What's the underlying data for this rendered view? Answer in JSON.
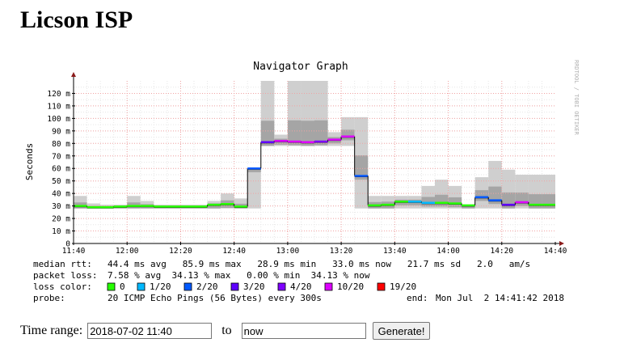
{
  "page": {
    "title": "Licson ISP"
  },
  "graph": {
    "title": "Navigator Graph",
    "ylabel": "Seconds",
    "watermark": "RRDTOOL / TOBI OETIKER",
    "stats": {
      "median_label": "median rtt:",
      "median_values": "44.4 ms avg   85.9 ms max   28.9 ms min   33.0 ms now   21.7 ms sd   2.0   am/s",
      "loss_label": "packet loss:",
      "loss_values": "7.58 % avg  34.13 % max   0.00 % min  34.13 % now",
      "color_label": "loss color:",
      "probe_label": "probe:",
      "probe_values": "20 ICMP Echo Pings (56 Bytes) every 300s",
      "end_label": "end:",
      "end_value": "Mon Jul  2 14:41:42 2018"
    },
    "loss_legend": [
      {
        "label": "0",
        "color": "#26ff00"
      },
      {
        "label": "1/20",
        "color": "#00b8ff"
      },
      {
        "label": "2/20",
        "color": "#0059ff"
      },
      {
        "label": "3/20",
        "color": "#5e00ff"
      },
      {
        "label": "4/20",
        "color": "#7e00ff"
      },
      {
        "label": "10/20",
        "color": "#dd00ff"
      },
      {
        "label": "19/20",
        "color": "#ff0000"
      }
    ]
  },
  "chart_data": {
    "type": "line",
    "ylabel": "Seconds",
    "ylim": [
      0,
      130
    ],
    "yticks": [
      0,
      10,
      20,
      30,
      40,
      50,
      60,
      70,
      80,
      90,
      100,
      110,
      120
    ],
    "ytick_labels": [
      "0",
      "10 m",
      "20 m",
      "30 m",
      "40 m",
      "50 m",
      "60 m",
      "70 m",
      "80 m",
      "90 m",
      "100 m",
      "110 m",
      "120 m"
    ],
    "xticks": [
      "11:40",
      "12:00",
      "12:20",
      "12:40",
      "13:00",
      "13:20",
      "13:40",
      "14:00",
      "14:20",
      "14:40"
    ],
    "grid": true,
    "series": [
      {
        "x": [
          "11:40",
          "11:45",
          "11:50",
          "11:55",
          "12:00",
          "12:05",
          "12:10",
          "12:15",
          "12:20",
          "12:25",
          "12:30",
          "12:35",
          "12:40",
          "12:45",
          "12:50",
          "12:55",
          "13:00",
          "13:05",
          "13:10",
          "13:15",
          "13:20",
          "13:25",
          "13:30",
          "13:35",
          "13:40",
          "13:45",
          "13:50",
          "13:55",
          "14:00",
          "14:05",
          "14:10",
          "14:15",
          "14:20",
          "14:25",
          "14:30",
          "14:35"
        ],
        "values": [
          30,
          29,
          29,
          29.5,
          30,
          30,
          29.5,
          29.5,
          29.5,
          29.5,
          31,
          31.5,
          29.5,
          60,
          81,
          82,
          81.5,
          81,
          81.5,
          83,
          85.5,
          54,
          30.5,
          31,
          33.5,
          33.5,
          32.5,
          32.5,
          32,
          30.5,
          37,
          34.5,
          31,
          33,
          31,
          31
        ],
        "loss": [
          "0",
          "0",
          "0",
          "0",
          "0",
          "0",
          "0",
          "0",
          "0",
          "0",
          "0",
          "0",
          "0",
          "2/20",
          "3/20",
          "10/20",
          "10/20",
          "10/20",
          "4/20",
          "10/20",
          "10/20",
          "2/20",
          "0",
          "0",
          "0",
          "1/20",
          "1/20",
          "0",
          "0",
          "0",
          "2/20",
          "2/20",
          "3/20",
          "10/20",
          "0",
          "0"
        ],
        "max": [
          38,
          32,
          31,
          31,
          38,
          34,
          31,
          31,
          31,
          31,
          34,
          40,
          36,
          60,
          130,
          87,
          130,
          130,
          130,
          89,
          101,
          101,
          38,
          38,
          38,
          38,
          46,
          51,
          46,
          31,
          53,
          66,
          59,
          55,
          55,
          55
        ],
        "min": [
          28,
          28,
          28,
          28,
          28,
          28,
          28,
          28,
          28,
          28,
          28,
          28,
          28,
          28,
          78,
          78,
          78,
          78,
          78,
          78,
          78,
          28,
          28,
          28,
          28,
          28,
          28,
          28,
          28,
          28,
          28,
          28,
          28,
          28,
          28,
          28
        ]
      }
    ]
  },
  "controls": {
    "time_range_label": "Time range:",
    "start_value": "2018-07-02 11:40",
    "to_label": "to",
    "end_value": "now",
    "generate_label": "Generate!"
  }
}
